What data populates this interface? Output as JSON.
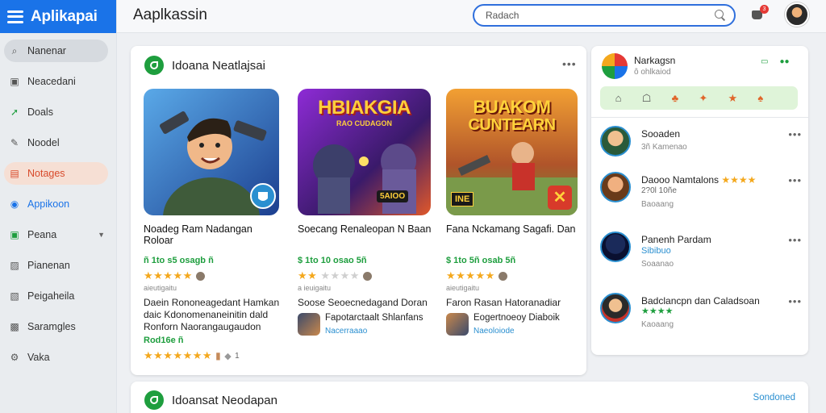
{
  "app": {
    "brand": "Aplikapai",
    "page_title": "Aaplkassin"
  },
  "search": {
    "placeholder": "Radach"
  },
  "header": {
    "cart_badge": "3"
  },
  "sidebar": {
    "items": [
      {
        "label": "Nanenar",
        "icon": "search-icon"
      },
      {
        "label": "Neacedani",
        "icon": "calendar-icon"
      },
      {
        "label": "Doals",
        "icon": "share-icon"
      },
      {
        "label": "Noodel",
        "icon": "pencil-icon"
      },
      {
        "label": "Notages",
        "icon": "folder-icon"
      },
      {
        "label": "Appikoon",
        "icon": "circle-icon"
      },
      {
        "label": "Peana",
        "icon": "check-square-icon"
      },
      {
        "label": "Pianenan",
        "icon": "image-icon"
      },
      {
        "label": "Peigaheila",
        "icon": "image-icon"
      },
      {
        "label": "Saramgles",
        "icon": "photo-icon"
      },
      {
        "label": "Vaka",
        "icon": "settings-icon"
      }
    ]
  },
  "main": {
    "section_title": "Idoana Neatlajsai",
    "games": [
      {
        "thumb_title": "",
        "title": "Noadeg Ram Nadangan Roloar",
        "meta": "ñ 1to s5 osagb ñ",
        "stars_on": 5,
        "stars_off": 0,
        "small": "aieutigaitu",
        "desc": "Daein Rononeagedant Hamkan daic Kdonomenaneinitin dald Ronforn Naorangaugaudon",
        "foot": "Rod16e ñ",
        "extra_stars": "★★★★★★★",
        "extra_count": "1"
      },
      {
        "thumb_title": "HBIAKGIA",
        "thumb_sub": "RAO CUDAGON",
        "thumb_badge": "5AIOO",
        "title": "Soecang Renaleopan N Baan",
        "meta": "$ 1to 10 osao 5ñ",
        "stars_on": 2,
        "stars_off": 4,
        "small": "a ieuigaitu",
        "desc": "Soose Seoecnedagand Doran",
        "dev": "Fapotarctaalt Shlanfans",
        "dev_link": "Nacerraaao"
      },
      {
        "thumb_title": "BUAKOM",
        "thumb_sub": "CUNTEARN",
        "thumb_badge": "INE",
        "title": "Fana Nckamang Sagafi. Dan",
        "meta": "$ 1to 5ñ osab 5ñ",
        "stars_on": 5,
        "stars_off": 0,
        "small": "aieutigaitu",
        "desc": "Faron Rasan Hatoranadiar",
        "dev": "Eogertnoeoy Diaboik",
        "dev_link": "Naeoloiode"
      }
    ]
  },
  "profile": {
    "name": "Narkagsn",
    "sub": "ô ohlkaiod",
    "actions": [
      "▭",
      "●●"
    ]
  },
  "quick_actions": [
    "⌂",
    "☖",
    "♣",
    "✦",
    "★",
    "♠"
  ],
  "friends": [
    {
      "name": "Sooaden",
      "sub": "3ñ Kamenao",
      "stars": "",
      "line2": ""
    },
    {
      "name": "Daooo Namtalons",
      "sub": "2?0l 10ñe",
      "stars": "★★★★",
      "line2": "Baoaang"
    },
    {
      "name": "Panenh Pardam",
      "sub": "Sibibuo",
      "stars": "",
      "line2": "Soaanao"
    },
    {
      "name": "Badclancpn dan Caladsoan",
      "sub": "",
      "stars": "★★★★",
      "line2": "Kaoaang"
    }
  ],
  "bottom": {
    "section_title": "Idoansat Neodapan",
    "see_all": "Sondoned"
  },
  "colors": {
    "brand": "#1a73e8",
    "accent_green": "#1e9e3e",
    "accent_orange": "#d84a2b",
    "star": "#f4a81d"
  }
}
